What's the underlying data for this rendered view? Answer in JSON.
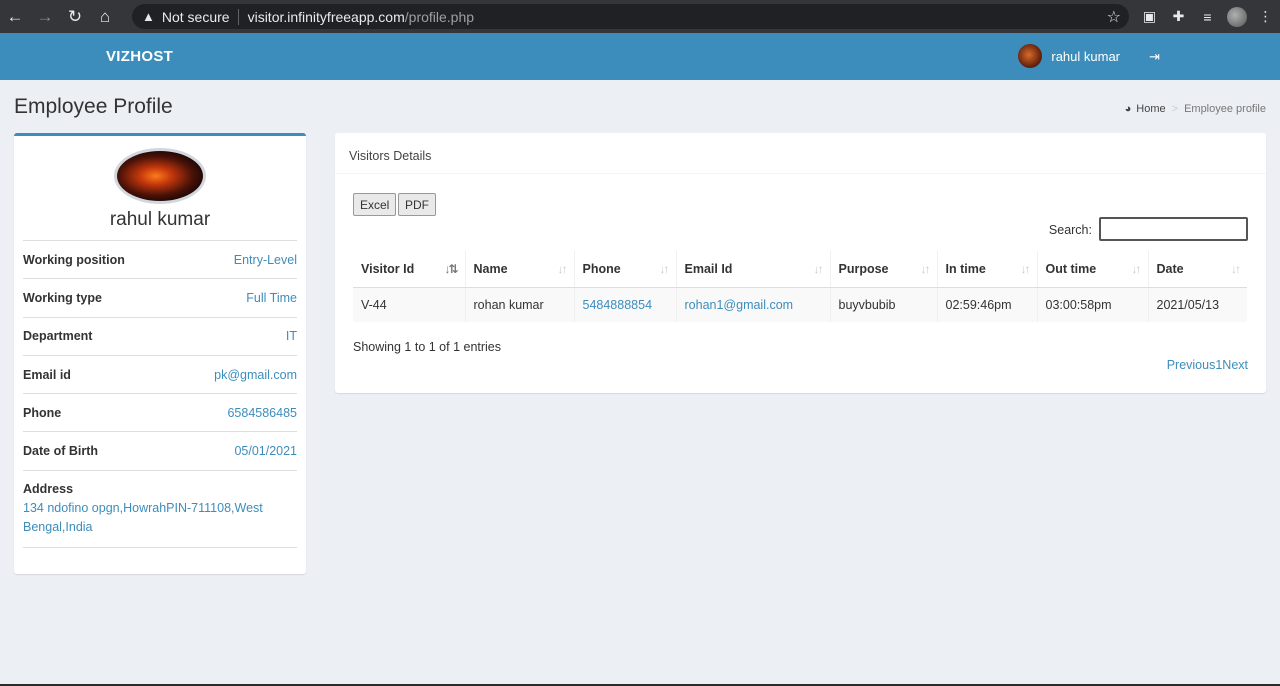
{
  "browser": {
    "security_label": "Not secure",
    "url_host": "visitor.infinityfreeapp.com",
    "url_path": "/profile.php"
  },
  "header": {
    "brand": "VIZHOST",
    "user_name": "rahul kumar"
  },
  "content_header": {
    "title": "Employee Profile",
    "breadcrumb_home": "Home",
    "breadcrumb_current": "Employee profile"
  },
  "profile": {
    "name": "rahul kumar",
    "fields": [
      {
        "label": "Working position",
        "value": "Entry-Level"
      },
      {
        "label": "Working type",
        "value": "Full Time"
      },
      {
        "label": "Department",
        "value": "IT"
      },
      {
        "label": "Email id",
        "value": "pk@gmail.com"
      },
      {
        "label": "Phone",
        "value": "6584586485"
      },
      {
        "label": "Date of Birth",
        "value": "05/01/2021"
      }
    ],
    "address_label": "Address",
    "address_value": "134 ndofino opgn,HowrahPIN-711108,West Bengal,India"
  },
  "visitors": {
    "title": "Visitors Details",
    "excel_label": "Excel",
    "pdf_label": "PDF",
    "search_label": "Search:",
    "columns": [
      "Visitor Id",
      "Name",
      "Phone",
      "Email Id",
      "Purpose",
      "In time",
      "Out time",
      "Date"
    ],
    "rows": [
      [
        "V-44",
        "rohan kumar",
        "5484888854",
        "rohan1@gmail.com",
        "buyvbubib",
        "02:59:46pm",
        "03:00:58pm",
        "2021/05/13"
      ]
    ],
    "showing": "Showing 1 to 1 of 1 entries",
    "pager": "Previous1Next"
  },
  "colors": {
    "header_blue": "#3c8dbc",
    "link_blue": "#3c8dbc",
    "page_bg": "#ecf0f5"
  }
}
